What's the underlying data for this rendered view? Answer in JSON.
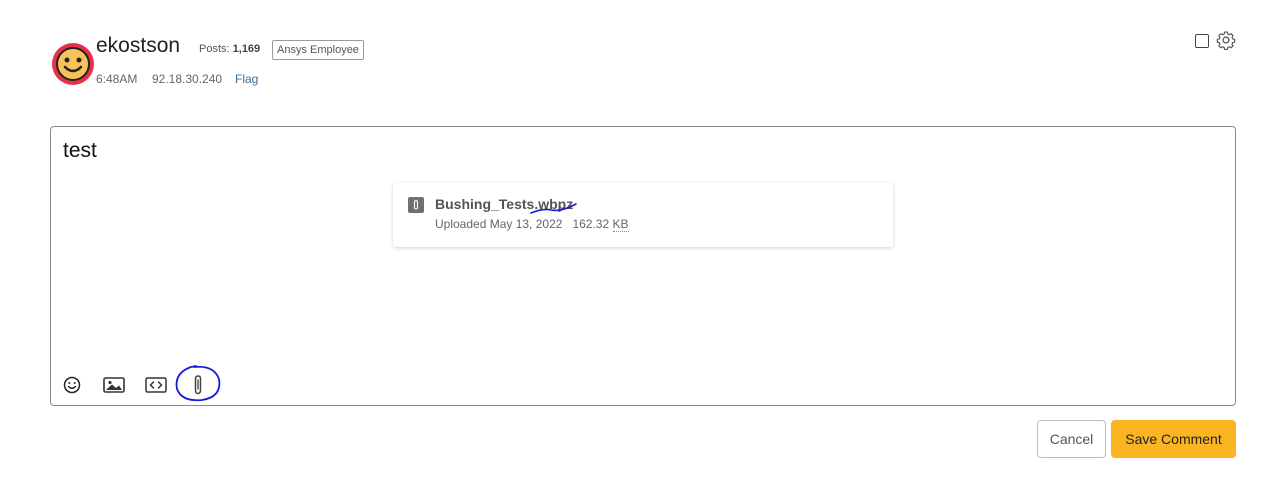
{
  "post": {
    "username": "ekostson",
    "posts_label": "Posts:",
    "posts_count": "1,169",
    "role": "Ansys Employee",
    "time": "6:48AM",
    "ip": "92.18.30.240",
    "flag": "Flag"
  },
  "editor": {
    "text": "test",
    "attachment": {
      "filename": "Bushing_Tests.wbpz",
      "uploaded": "Uploaded May 13, 2022",
      "size": "162.32",
      "size_unit": "KB"
    }
  },
  "toolbar": [
    "emoji-icon",
    "image-icon",
    "code-icon",
    "paperclip-icon"
  ],
  "buttons": {
    "cancel": "Cancel",
    "save": "Save Comment"
  },
  "colors": {
    "accent": "#fbb522",
    "avatar": "#e8304a",
    "link": "#3f6e9a",
    "annotation": "#1a1ad6"
  }
}
